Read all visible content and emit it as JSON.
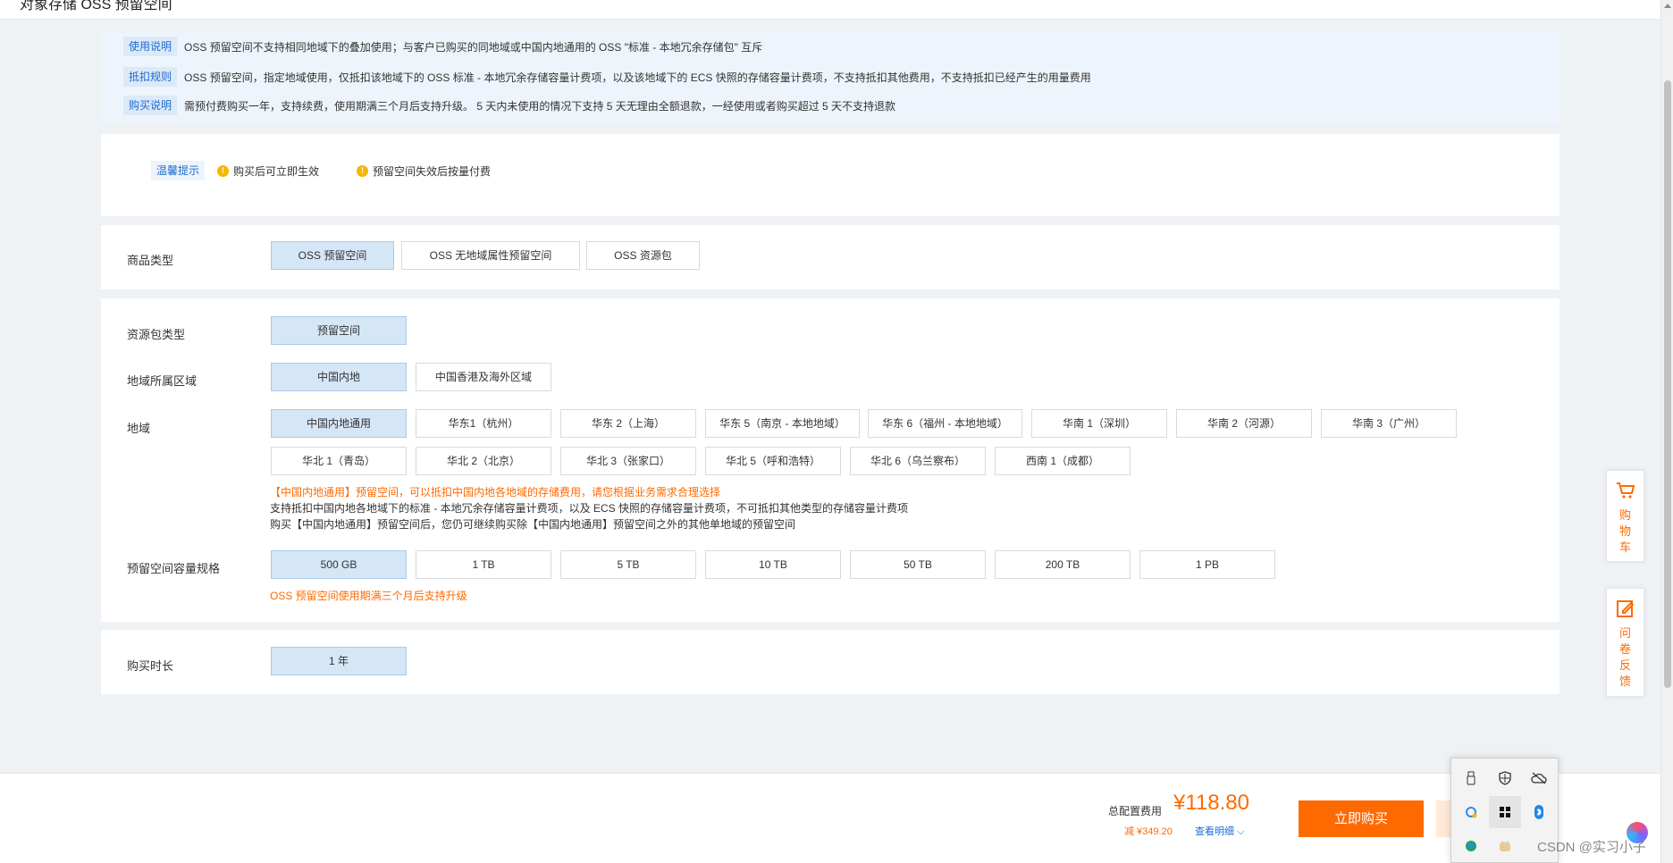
{
  "page": {
    "title": "对象存储 OSS 预留空间"
  },
  "notice": [
    {
      "tag": "使用说明",
      "text": "OSS 预留空间不支持相同地域下的叠加使用；与客户已购买的同地域或中国内地通用的 OSS \"标准 - 本地冗余存储包\" 互斥"
    },
    {
      "tag": "抵扣规则",
      "text": "OSS 预留空间，指定地域使用，仅抵扣该地域下的 OSS 标准 - 本地冗余存储容量计费项，以及该地域下的 ECS 快照的存储容量计费项，不支持抵扣其他费用，不支持抵扣已经产生的用量费用"
    },
    {
      "tag": "购买说明",
      "text": "需预付费购买一年，支持续费，使用期满三个月后支持升级。 5 天内未使用的情况下支持 5 天无理由全额退款，一经使用或者购买超过 5 天不支持退款"
    }
  ],
  "tips": {
    "tag": "温馨提示",
    "items": [
      "购买后可立即生效",
      "预留空间失效后按量付费"
    ]
  },
  "product_type": {
    "label": "商品类型",
    "options": [
      "OSS 预留空间",
      "OSS 无地域属性预留空间",
      "OSS 资源包"
    ],
    "selected": "OSS 预留空间"
  },
  "package_type": {
    "label": "资源包类型",
    "options": [
      "预留空间"
    ],
    "selected": "预留空间"
  },
  "area": {
    "label": "地域所属区域",
    "options": [
      "中国内地",
      "中国香港及海外区域"
    ],
    "selected": "中国内地"
  },
  "region": {
    "label": "地域",
    "row1": [
      "中国内地通用",
      "华东1（杭州）",
      "华东 2（上海）",
      "华东 5（南京 - 本地地域）",
      "华东 6（福州 - 本地地域）",
      "华南 1（深圳）",
      "华南 2（河源）",
      "华南 3（广州）"
    ],
    "row2": [
      "华北 1（青岛）",
      "华北 2（北京）",
      "华北 3（张家口）",
      "华北 5（呼和浩特）",
      "华北 6（乌兰察布）",
      "西南 1（成都）"
    ],
    "selected": "中国内地通用",
    "note_warn": "【中国内地通用】预留空间，可以抵扣中国内地各地域的存储费用，请您根据业务需求合理选择",
    "note1": "支持抵扣中国内地各地域下的标准 - 本地冗余存储容量计费项，以及 ECS 快照的存储容量计费项，不可抵扣其他类型的存储容量计费项",
    "note2": "购买【中国内地通用】预留空间后，您仍可继续购买除【中国内地通用】预留空间之外的其他单地域的预留空间"
  },
  "capacity": {
    "label": "预留空间容量规格",
    "options": [
      "500 GB",
      "1 TB",
      "5 TB",
      "10 TB",
      "50 TB",
      "200 TB",
      "1 PB"
    ],
    "selected": "500 GB",
    "note": "OSS 预留空间使用期满三个月后支持升级"
  },
  "duration": {
    "label": "购买时长",
    "options": [
      "1 年"
    ],
    "selected": "1 年"
  },
  "footer": {
    "total_label": "总配置费用",
    "price": "¥118.80",
    "discount": "减 ¥349.20",
    "detail": "查看明细",
    "buy_label": "立即购买"
  },
  "side": {
    "cart": "购物车",
    "feedback": "问卷反馈"
  },
  "watermark": "CSDN @实习小子",
  "colors": {
    "accent": "#ff6a00",
    "selected_bg": "#d5e6f7",
    "link": "#1b6bd1"
  }
}
